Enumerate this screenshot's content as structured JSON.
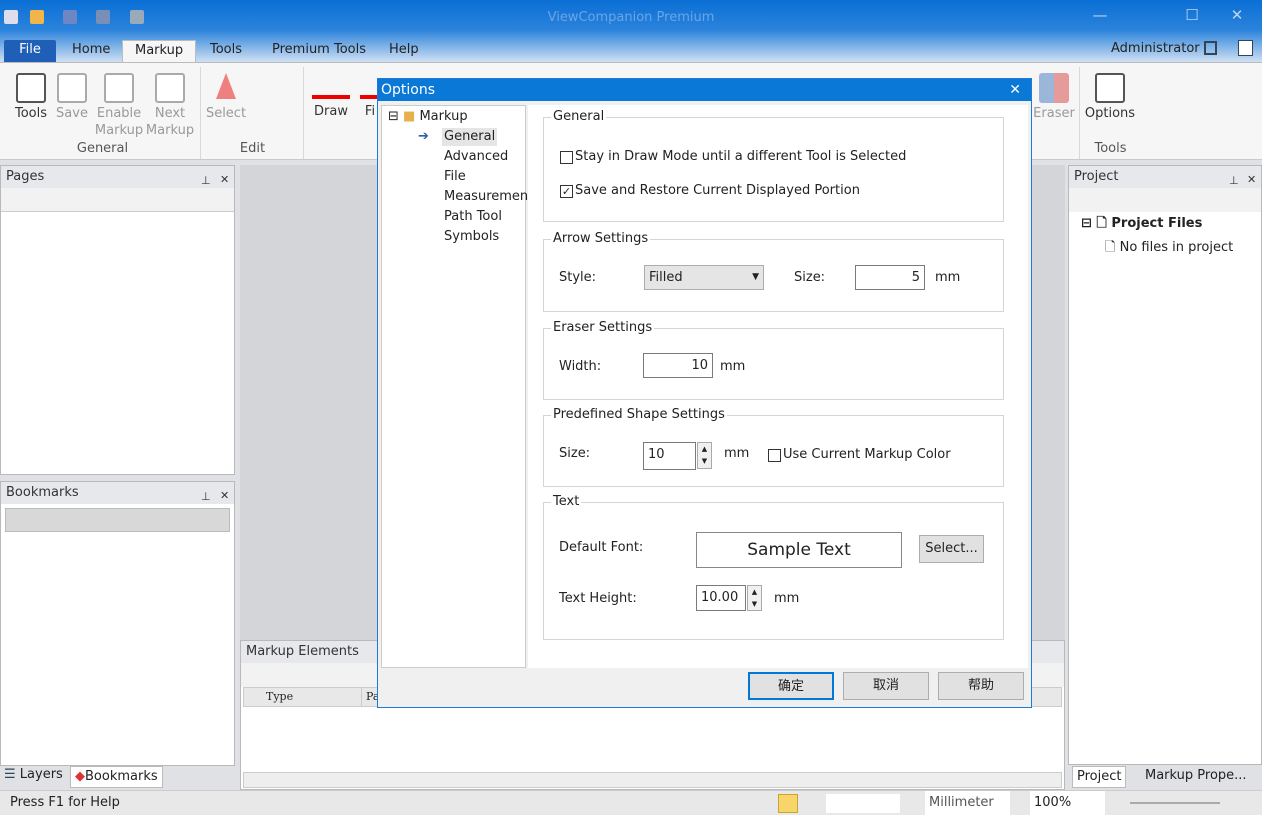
{
  "app": {
    "title": "ViewCompanion Premium",
    "user": "Administrator"
  },
  "tabs": [
    "File",
    "Home",
    "Markup",
    "Tools",
    "Premium Tools",
    "Help"
  ],
  "ribbon": {
    "general": {
      "label": "General",
      "buttons": [
        "Tools",
        "Save",
        "Enable Markup",
        "Next Markup"
      ]
    },
    "edit": {
      "label": "Edit",
      "buttons": [
        "Select"
      ]
    },
    "draw": {
      "buttons": [
        "Draw",
        "Fi"
      ]
    },
    "tools": {
      "label": "Tools",
      "buttons": [
        "Eraser",
        "Options"
      ]
    }
  },
  "pages_panel": {
    "title": "Pages"
  },
  "bookmarks_panel": {
    "title": "Bookmarks"
  },
  "left_tabs": [
    "Layers",
    "Bookmarks"
  ],
  "markup_panel": {
    "title": "Markup Elements",
    "columns": [
      "Type",
      "Pa"
    ]
  },
  "project_panel": {
    "title": "Project",
    "root": "Project Files",
    "empty": "No files in project"
  },
  "right_tabs": [
    "Project",
    "Markup Prope..."
  ],
  "status": {
    "help": "Press F1 for Help",
    "unit": "Millimeter",
    "zoom": "100%"
  },
  "dialog": {
    "title": "Options",
    "tree": {
      "root": "Markup",
      "items": [
        "General",
        "Advanced",
        "File",
        "Measurement",
        "Path Tool",
        "Symbols"
      ],
      "selected": "General"
    },
    "general": {
      "label": "General",
      "stay_draw": "Stay in Draw Mode until a different Tool is Selected",
      "stay_draw_checked": false,
      "save_restore": "Save and Restore Current Displayed Portion",
      "save_restore_checked": true
    },
    "arrow": {
      "label": "Arrow Settings",
      "style_label": "Style:",
      "style": "Filled",
      "size_label": "Size:",
      "size": "5",
      "unit": "mm"
    },
    "eraser": {
      "label": "Eraser Settings",
      "width_label": "Width:",
      "width": "10",
      "unit": "mm"
    },
    "shape": {
      "label": "Predefined Shape Settings",
      "size_label": "Size:",
      "size": "10",
      "unit": "mm",
      "use_color": "Use Current Markup Color",
      "use_color_checked": false
    },
    "text": {
      "label": "Text",
      "font_label": "Default Font:",
      "sample": "Sample Text",
      "select": "Select...",
      "height_label": "Text Height:",
      "height": "10.00",
      "unit": "mm"
    },
    "buttons": {
      "ok": "确定",
      "cancel": "取消",
      "help": "帮助"
    }
  }
}
